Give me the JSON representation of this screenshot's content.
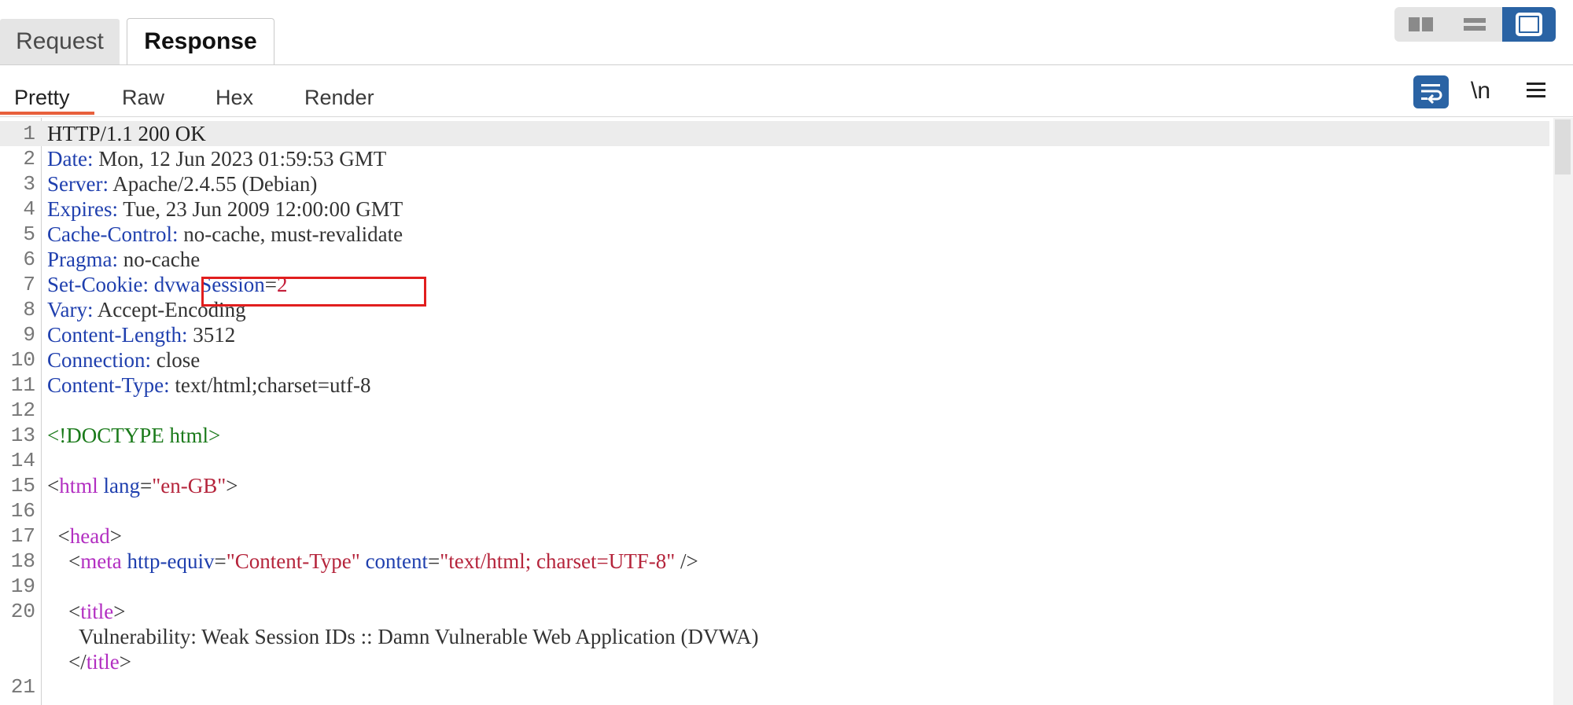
{
  "tabs": {
    "request_label": "Request",
    "response_label": "Response"
  },
  "subtabs": {
    "pretty": "Pretty",
    "raw": "Raw",
    "hex": "Hex",
    "render": "Render",
    "newline_label": "\\n"
  },
  "colors": {
    "accent_blue": "#2a63a4",
    "active_underline": "#e8603c",
    "highlight_box": "#e11e1e"
  },
  "icons": {
    "layout_side_by_side": "columns-icon",
    "layout_stacked": "rows-icon",
    "layout_single": "single-pane-icon",
    "wrap": "wrap-lines-icon",
    "menu": "hamburger-menu-icon"
  },
  "editor": {
    "lines": [
      {
        "n": "1",
        "name": "HTTP/1.1 200 OK"
      },
      {
        "n": "2",
        "name": "Date",
        "value": " Mon, 12 Jun 2023 01:59:53 GMT"
      },
      {
        "n": "3",
        "name": "Server",
        "value": " Apache/2.4.55 (Debian)"
      },
      {
        "n": "4",
        "name": "Expires",
        "value": " Tue, 23 Jun 2009 12:00:00 GMT"
      },
      {
        "n": "5",
        "name": "Cache-Control",
        "value": " no-cache, must-revalidate"
      },
      {
        "n": "6",
        "name": "Pragma",
        "value": " no-cache"
      },
      {
        "n": "7",
        "name": "Set-Cookie",
        "cookie_name": "dvwaSession",
        "cookie_value": "2"
      },
      {
        "n": "8",
        "name": "Vary",
        "value": " Accept-Encoding"
      },
      {
        "n": "9",
        "name": "Content-Length",
        "value": " 3512"
      },
      {
        "n": "10",
        "name": "Connection",
        "value": " close"
      },
      {
        "n": "11",
        "name": "Content-Type",
        "value": " text/html;charset=utf-8"
      },
      {
        "n": "12"
      },
      {
        "n": "13",
        "doctype": "<!DOCTYPE html>"
      },
      {
        "n": "14"
      },
      {
        "n": "15",
        "tag": "html",
        "attr": "lang",
        "attr_value": "\"en-GB\""
      },
      {
        "n": "16"
      },
      {
        "n": "17",
        "tag": "head"
      },
      {
        "n": "18",
        "tag": "meta",
        "attr1": "http-equiv",
        "val1": "\"Content-Type\"",
        "attr2": "content",
        "val2": "\"text/html; charset=UTF-8\""
      },
      {
        "n": "19"
      },
      {
        "n": "20",
        "tag": "title",
        "text": "Vulnerability: Weak Session IDs :: Damn Vulnerable Web Application (DVWA)",
        "close": "title"
      },
      {
        "n": "21"
      }
    ]
  }
}
